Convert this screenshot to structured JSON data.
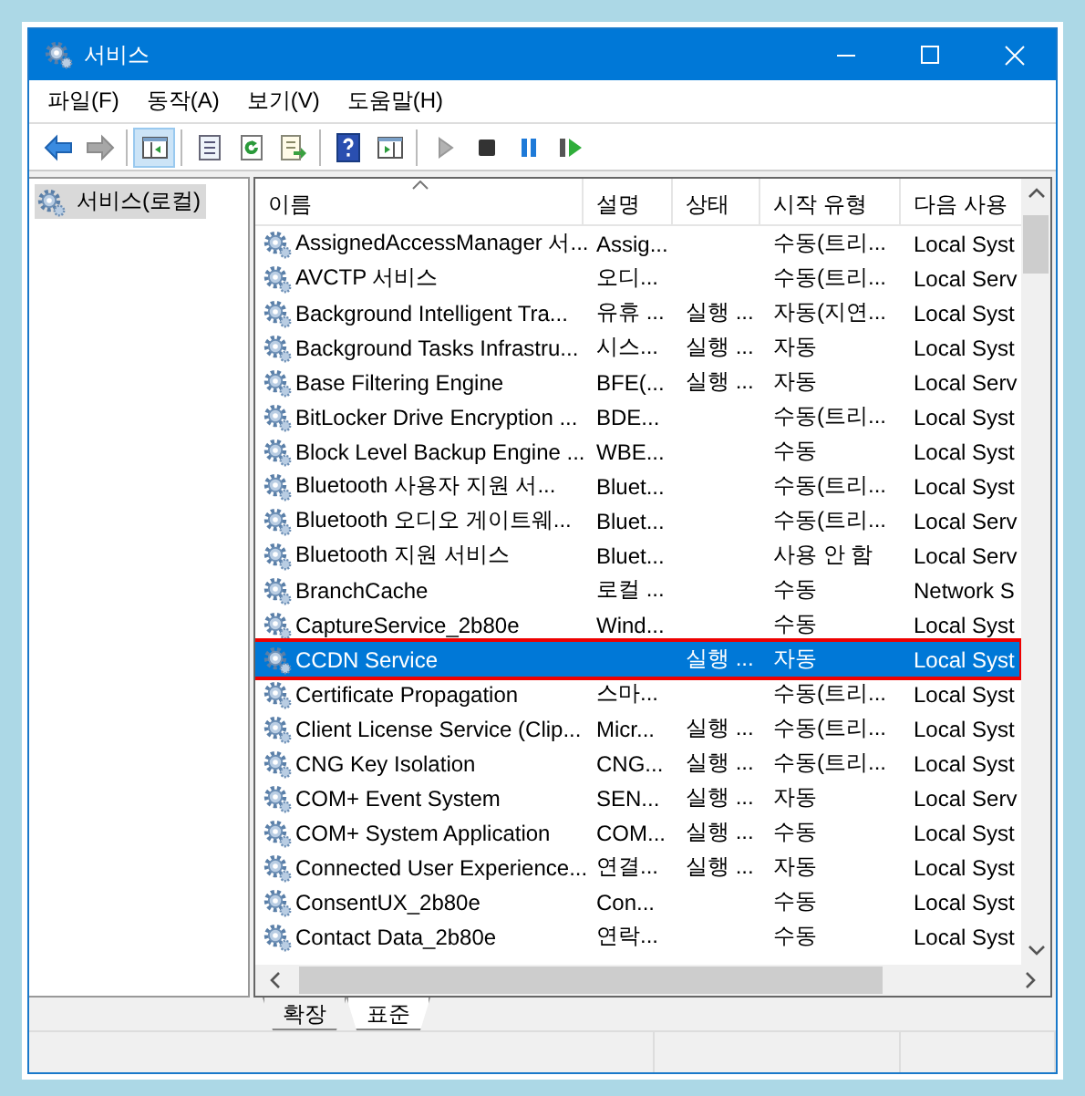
{
  "window": {
    "title": "서비스"
  },
  "menu": [
    "파일(F)",
    "동작(A)",
    "보기(V)",
    "도움말(H)"
  ],
  "toolbar": [
    {
      "kind": "back",
      "disabled": false
    },
    {
      "kind": "forward",
      "disabled": true
    },
    {
      "kind": "sep"
    },
    {
      "kind": "tree",
      "pressed": true
    },
    {
      "kind": "sep"
    },
    {
      "kind": "properties"
    },
    {
      "kind": "refresh"
    },
    {
      "kind": "export"
    },
    {
      "kind": "sep"
    },
    {
      "kind": "help"
    },
    {
      "kind": "pane",
      "pressed": false
    },
    {
      "kind": "sep"
    },
    {
      "kind": "start",
      "disabled": true
    },
    {
      "kind": "stop",
      "disabled": false
    },
    {
      "kind": "pause",
      "disabled": false
    },
    {
      "kind": "resume",
      "disabled": false
    }
  ],
  "tree": {
    "items": [
      {
        "label": "서비스(로컬)",
        "selected": true
      }
    ]
  },
  "table": {
    "columns": [
      "이름",
      "설명",
      "상태",
      "시작 유형",
      "다음 사용"
    ],
    "rows": [
      {
        "name": "AssignedAccessManager 서...",
        "description": "Assig...",
        "startup": "수동(트리...",
        "logon": "Local Syst",
        "selected": false
      },
      {
        "name": "AVCTP 서비스",
        "description": "오디...",
        "startup": "수동(트리...",
        "logon": "Local Serv",
        "selected": false
      },
      {
        "name": "Background Intelligent Tra...",
        "description": "유휴 ...",
        "status": "실행 ...",
        "startup": "자동(지연...",
        "logon": "Local Syst",
        "selected": false
      },
      {
        "name": "Background Tasks Infrastru...",
        "description": "시스...",
        "status": "실행 ...",
        "startup": "자동",
        "logon": "Local Syst",
        "selected": false
      },
      {
        "name": "Base Filtering Engine",
        "description": "BFE(...",
        "status": "실행 ...",
        "startup": "자동",
        "logon": "Local Serv",
        "selected": false
      },
      {
        "name": "BitLocker Drive Encryption ...",
        "description": "BDE...",
        "startup": "수동(트리...",
        "logon": "Local Syst",
        "selected": false
      },
      {
        "name": "Block Level Backup Engine ...",
        "description": "WBE...",
        "startup": "수동",
        "logon": "Local Syst",
        "selected": false
      },
      {
        "name": "Bluetooth 사용자 지원 서...",
        "description": "Bluet...",
        "startup": "수동(트리...",
        "logon": "Local Syst",
        "selected": false
      },
      {
        "name": "Bluetooth 오디오 게이트웨...",
        "description": "Bluet...",
        "startup": "수동(트리...",
        "logon": "Local Serv",
        "selected": false
      },
      {
        "name": "Bluetooth 지원 서비스",
        "description": "Bluet...",
        "startup": "사용 안 함",
        "logon": "Local Serv",
        "selected": false
      },
      {
        "name": "BranchCache",
        "description": "로컬 ...",
        "startup": "수동",
        "logon": "Network S",
        "selected": false
      },
      {
        "name": "CaptureService_2b80e",
        "description": "Wind...",
        "startup": "수동",
        "logon": "Local Syst",
        "selected": false
      },
      {
        "name": "CCDN Service",
        "status": "실행 ...",
        "startup": "자동",
        "logon": "Local Syst",
        "selected": true,
        "highlighted": true
      },
      {
        "name": "Certificate Propagation",
        "description": "스마...",
        "startup": "수동(트리...",
        "logon": "Local Syst",
        "selected": false
      },
      {
        "name": "Client License Service (Clip...",
        "description": "Micr...",
        "status": "실행 ...",
        "startup": "수동(트리...",
        "logon": "Local Syst",
        "selected": false
      },
      {
        "name": "CNG Key Isolation",
        "description": "CNG...",
        "status": "실행 ...",
        "startup": "수동(트리...",
        "logon": "Local Syst",
        "selected": false
      },
      {
        "name": "COM+ Event System",
        "description": "SEN...",
        "status": "실행 ...",
        "startup": "자동",
        "logon": "Local Serv",
        "selected": false
      },
      {
        "name": "COM+ System Application",
        "description": "COM...",
        "status": "실행 ...",
        "startup": "수동",
        "logon": "Local Syst",
        "selected": false
      },
      {
        "name": "Connected User Experience...",
        "description": "연결...",
        "status": "실행 ...",
        "startup": "자동",
        "logon": "Local Syst",
        "selected": false
      },
      {
        "name": "ConsentUX_2b80e",
        "description": "Con...",
        "startup": "수동",
        "logon": "Local Syst",
        "selected": false
      },
      {
        "name": "Contact Data_2b80e",
        "description": "연락...",
        "startup": "수동",
        "logon": "Local Syst",
        "selected": false
      }
    ]
  },
  "view_tabs": [
    {
      "label": "확장",
      "selected": false
    },
    {
      "label": "표준",
      "selected": true
    }
  ]
}
